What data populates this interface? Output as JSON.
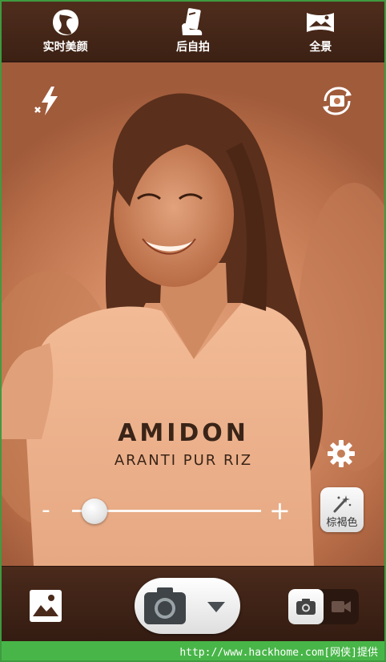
{
  "top_modes": [
    {
      "label": "实时美颜",
      "icon": "beauty-face-icon"
    },
    {
      "label": "后自拍",
      "icon": "selfie-hand-icon"
    },
    {
      "label": "全景",
      "icon": "panorama-icon"
    }
  ],
  "viewfinder": {
    "flash_icon": "flash-off-icon",
    "switch_camera_icon": "switch-camera-icon",
    "settings_icon": "gear-icon",
    "photo_shirt_text_1": "AMIDON",
    "photo_shirt_text_2": "ARANTI PUR RIZ",
    "slider": {
      "minus": "-",
      "plus": "+",
      "value": 0.12
    },
    "filter": {
      "label": "棕褐色",
      "icon": "magic-wand-icon"
    }
  },
  "bottom": {
    "gallery_icon": "gallery-icon",
    "shutter_icon": "camera-icon",
    "shutter_menu_icon": "caret-down-icon",
    "mode_photo_icon": "photo-mode-icon",
    "mode_video_icon": "video-mode-icon"
  },
  "footer_text": "http://www.hackhome.com[网侠]提供",
  "colors": {
    "accent_brown": "#3c2114",
    "sepia": "#d38a63",
    "footer_green": "#48b548"
  }
}
